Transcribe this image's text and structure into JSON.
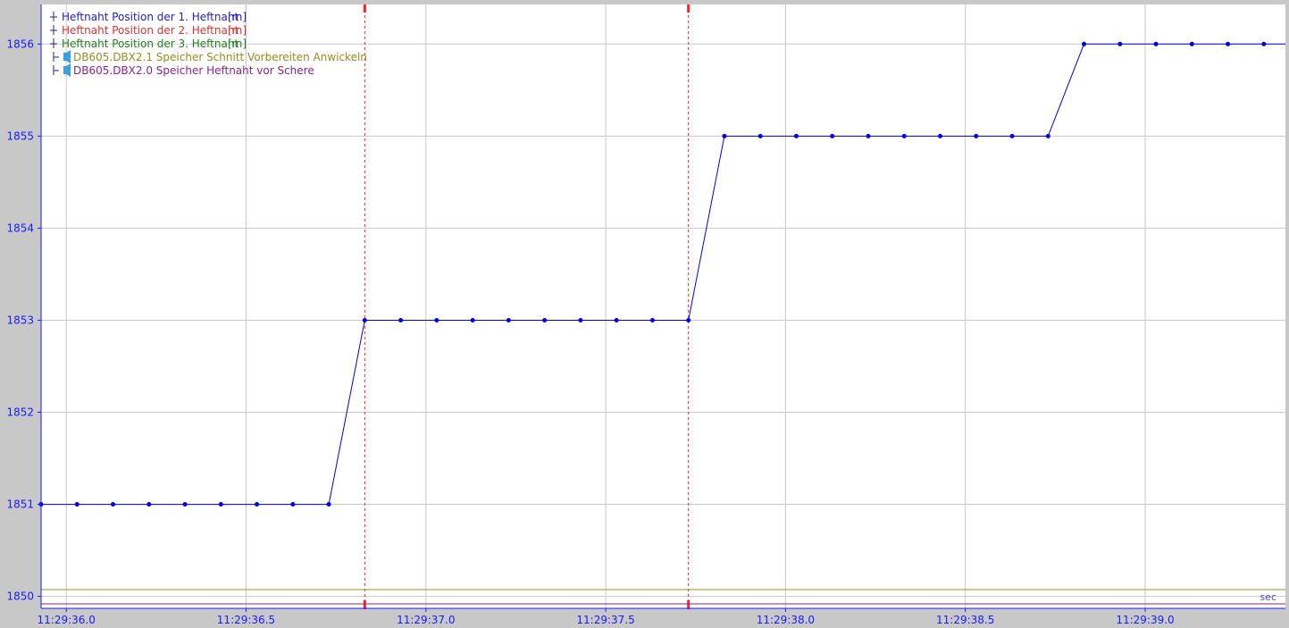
{
  "chart_data": {
    "type": "line",
    "x_unit": "sec",
    "y_ticks": [
      "1850",
      "1851",
      "1852",
      "1853",
      "1854",
      "1855",
      "1856"
    ],
    "x_ticks": [
      "11:29:36.0",
      "11:29:36.5",
      "11:29:37.0",
      "11:29:37.5",
      "11:29:38.0",
      "11:29:38.5",
      "11:29:39.0"
    ],
    "xlim": [
      35.93,
      39.39
    ],
    "ylim": [
      1849.87,
      1856.43
    ],
    "legend": [
      {
        "label": "Heftnaht Position der 1. Heftnaht",
        "unit": "[m]",
        "color": "#2020d0",
        "marker": "line"
      },
      {
        "label": "Heftnaht Position der 2. Heftnaht",
        "unit": "[m]",
        "color": "#e03030",
        "marker": "line"
      },
      {
        "label": "Heftnaht Position der 3. Heftnaht",
        "unit": "[m]",
        "color": "#208020",
        "marker": "line"
      },
      {
        "label": "DB605.DBX2.1 Speicher Schnitt Vorbereiten Anwickeln",
        "unit": "",
        "color": "#909020",
        "marker": "speaker"
      },
      {
        "label": "DB605.DBX2.0 Speicher Heftnaht vor Schere",
        "unit": "",
        "color": "#902090",
        "marker": "speaker"
      }
    ],
    "cursors": [
      36.83,
      37.73
    ],
    "series": [
      {
        "name": "Heftnaht Position der 1. Heftnaht",
        "color": "#0000ee",
        "x": [
          35.93,
          36.03,
          36.13,
          36.23,
          36.33,
          36.43,
          36.53,
          36.63,
          36.73,
          36.83,
          36.93,
          37.03,
          37.13,
          37.23,
          37.33,
          37.43,
          37.53,
          37.63,
          37.73,
          37.83,
          37.93,
          38.03,
          38.13,
          38.23,
          38.33,
          38.43,
          38.53,
          38.63,
          38.73,
          38.83,
          38.93,
          39.03,
          39.13,
          39.23,
          39.33,
          39.39
        ],
        "values": [
          1851,
          1851,
          1851,
          1851,
          1851,
          1851,
          1851,
          1851,
          1851,
          1853,
          1853,
          1853,
          1853,
          1853,
          1853,
          1853,
          1853,
          1853,
          1853,
          1855,
          1855,
          1855,
          1855,
          1855,
          1855,
          1855,
          1855,
          1855,
          1855,
          1856,
          1856,
          1856,
          1856,
          1856,
          1856,
          1856
        ],
        "markers": [
          true,
          true,
          true,
          true,
          true,
          true,
          true,
          true,
          true,
          true,
          true,
          true,
          true,
          true,
          true,
          true,
          true,
          true,
          true,
          true,
          true,
          true,
          true,
          true,
          true,
          true,
          true,
          true,
          true,
          true,
          true,
          true,
          true,
          true,
          true,
          false
        ]
      }
    ],
    "digital_lines": [
      {
        "name": "DB605.DBX2.1 Speicher Schnitt Vorbereiten Anwickeln",
        "color": "#909020",
        "level": 0
      },
      {
        "name": "DB605.DBX2.0 Speicher Heftnaht vor Schere",
        "color": "#902090",
        "level": 0
      }
    ]
  }
}
